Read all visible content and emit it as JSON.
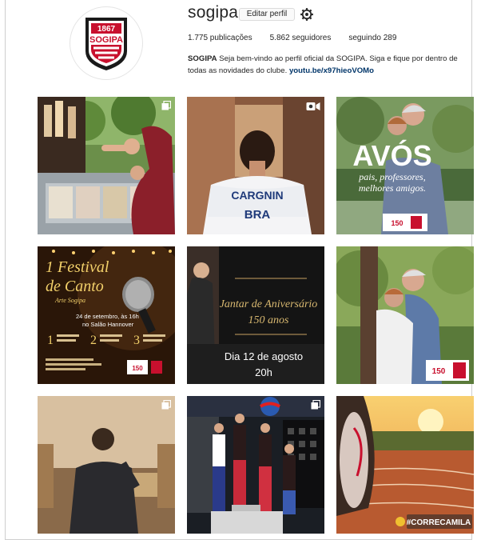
{
  "profile": {
    "username": "sogipa",
    "edit_label": "Editar perfil",
    "publications": "1.775 publicações",
    "followers": "5.862 seguidores",
    "following": "seguindo 289",
    "bio_name": "SOGIPA",
    "bio_text": " Seja bem-vindo ao perfil oficial da SOGIPA. Siga e fique por dentro de todas as novidades do clube. ",
    "bio_link": "youtu.be/x97hieoVOMo"
  },
  "logo": {
    "year": "1867",
    "name": "SOGIPA"
  },
  "posts": {
    "p2": {
      "name": "CARGNIN",
      "country": "BRA"
    },
    "p3": {
      "title": "AVÓS",
      "line1": "pais, professores,",
      "line2": "melhores amigos.",
      "badge": "150"
    },
    "p4": {
      "title1": "1 Festival",
      "title2": "de Canto",
      "subtitle": "Arte Sogipa",
      "date1": "24 de setembro, às 16h",
      "date2": "no Salão Hannover",
      "n1": "1",
      "n2": "2",
      "n3": "3",
      "badge": "150"
    },
    "p5": {
      "title1": "Jantar de Aniversário",
      "title2": "150 anos",
      "date": "Dia 12 de agosto",
      "time": "20h"
    },
    "p6": {
      "badge": "150"
    },
    "p9": {
      "hashtag": "#CORRECAMILA"
    }
  },
  "colors": {
    "brand_red": "#c8102e",
    "link_blue": "#003569"
  },
  "icons": [
    "gear-icon",
    "multi-photo-icon",
    "video-icon"
  ]
}
